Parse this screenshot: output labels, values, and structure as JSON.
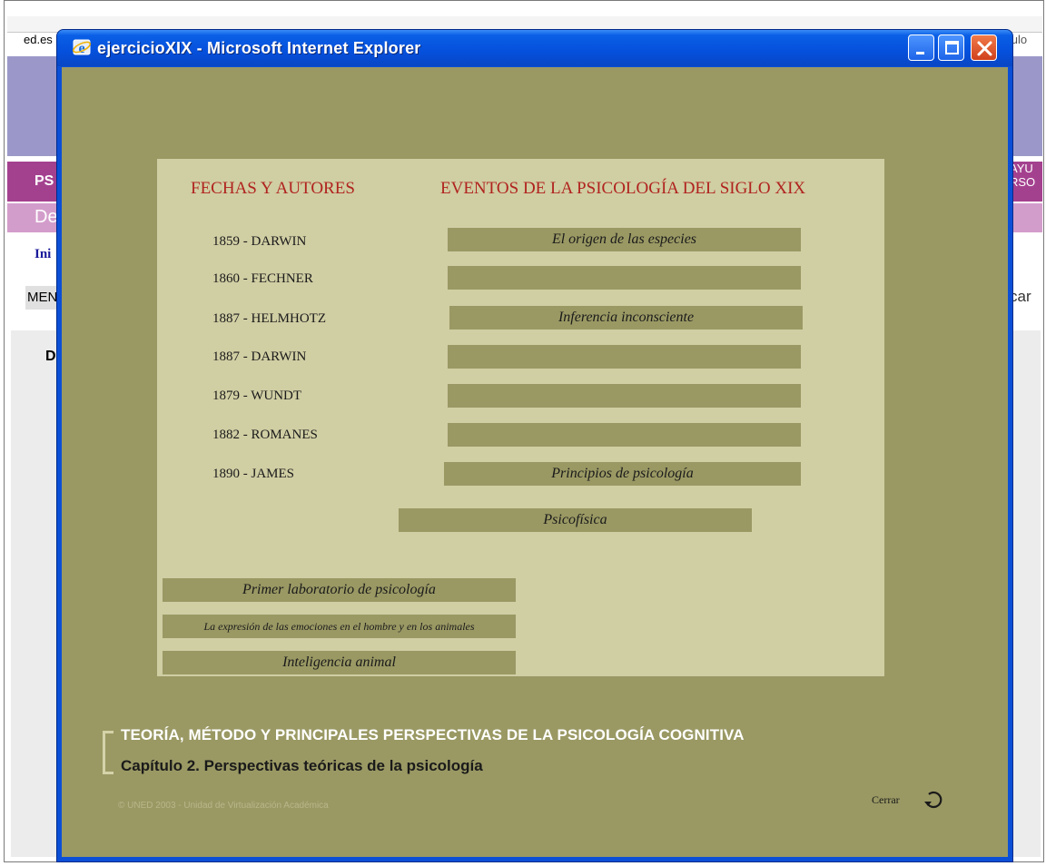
{
  "background": {
    "url_fragment": "ed.es",
    "url_right_fragment": "nculo",
    "section_code": "PS",
    "section_right": [
      "AYU",
      "RSO"
    ],
    "subheader": "De",
    "nav_link": "Ini",
    "menu_label": "MEN",
    "search_fragment": "car",
    "content_initial": "D"
  },
  "window": {
    "title": "ejercicioXIX - Microsoft Internet Explorer"
  },
  "exercise": {
    "dates_header": "FECHAS Y AUTORES",
    "events_header": "EVENTOS DE LA PSICOLOGÍA DEL SIGLO XIX",
    "rows": [
      {
        "label": "1859 - DARWIN",
        "answer": "El origen de las especies"
      },
      {
        "label": "1860 - FECHNER",
        "answer": ""
      },
      {
        "label": "1887  - HELMHOTZ",
        "answer": "Inferencia inconsciente"
      },
      {
        "label": "1887 - DARWIN",
        "answer": ""
      },
      {
        "label": "1879 - WUNDT",
        "answer": ""
      },
      {
        "label": "1882 - ROMANES",
        "answer": ""
      },
      {
        "label": "1890 - JAMES",
        "answer": "Principios de psicología"
      }
    ],
    "draggables": [
      "Psicofísica",
      "Primer laboratorio de psicología",
      "La expresión de las emociones en el hombre y en los animales",
      "Inteligencia animal"
    ]
  },
  "footer": {
    "course_title": "TEORÍA, MÉTODO Y PRINCIPALES PERSPECTIVAS DE LA PSICOLOGÍA COGNITIVA",
    "chapter": "Capítulo 2. Perspectivas teóricas de la psicología",
    "copyright": "© UNED 2003 - Unidad de Virtualización Académica",
    "close_label": "Cerrar"
  },
  "colors": {
    "content_bg": "#9a9964",
    "panel_bg": "#d0cea3",
    "header_red": "#b0231e",
    "titlebar_blue": "#0550dc",
    "close_red": "#d0401c"
  },
  "icons": [
    "ie-icon",
    "minimize-icon",
    "maximize-icon",
    "close-icon",
    "refresh-icon"
  ]
}
